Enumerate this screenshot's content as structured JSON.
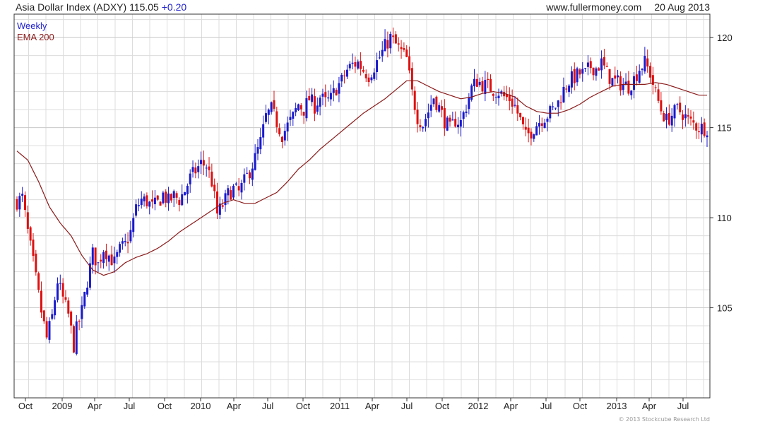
{
  "header": {
    "title": "Asia Dollar Index (ADXY)",
    "last": "115.05",
    "change": "+0.20",
    "site": "www.fullermoney.com",
    "date": "20 Aug 2013"
  },
  "copyright": "© 2013 Stockcube Research Ltd",
  "colors": {
    "up": "#1a1acc",
    "down": "#dd1111",
    "ema": "#8b1a1a",
    "grid": "#dcdcdc",
    "axis": "#333333"
  },
  "chart_data": {
    "type": "candlestick",
    "legend": [
      {
        "label": "Weekly",
        "color": "#2222cc"
      },
      {
        "label": "EMA 200",
        "color": "#8b1a1a"
      }
    ],
    "y_range": [
      100,
      121.3
    ],
    "y_ticks": [
      105,
      110,
      115,
      120
    ],
    "x_tick_labels": [
      "Oct",
      "2009",
      "Apr",
      "Jul",
      "Oct",
      "2010",
      "Apr",
      "Jul",
      "Oct",
      "2011",
      "Apr",
      "Jul",
      "Oct",
      "2012",
      "Apr",
      "Jul",
      "Oct",
      "2013",
      "Apr",
      "Jul"
    ],
    "weeks_total": 256,
    "close_path": [
      [
        0,
        110.9
      ],
      [
        2,
        111.1
      ],
      [
        4,
        109.2
      ],
      [
        6,
        107.5
      ],
      [
        9,
        104.8
      ],
      [
        11,
        103.3
      ],
      [
        13,
        104.5
      ],
      [
        15,
        106.5
      ],
      [
        17,
        105.5
      ],
      [
        19,
        104.6
      ],
      [
        21,
        102.9
      ],
      [
        22,
        103.8
      ],
      [
        24,
        104.8
      ],
      [
        26,
        106.5
      ],
      [
        28,
        108.0
      ],
      [
        30,
        107.4
      ],
      [
        32,
        108.3
      ],
      [
        34,
        107.9
      ],
      [
        36,
        107.5
      ],
      [
        38,
        108.2
      ],
      [
        40,
        108.5
      ],
      [
        42,
        109.2
      ],
      [
        44,
        110.5
      ],
      [
        46,
        111.0
      ],
      [
        48,
        110.9
      ],
      [
        50,
        110.6
      ],
      [
        52,
        110.8
      ],
      [
        54,
        111.3
      ],
      [
        56,
        110.9
      ],
      [
        58,
        111.2
      ],
      [
        60,
        111.0
      ],
      [
        62,
        111.5
      ],
      [
        64,
        112.2
      ],
      [
        66,
        112.6
      ],
      [
        68,
        113.0
      ],
      [
        70,
        112.9
      ],
      [
        72,
        112.0
      ],
      [
        74,
        110.2
      ],
      [
        76,
        110.7
      ],
      [
        78,
        111.3
      ],
      [
        80,
        111.6
      ],
      [
        82,
        111.4
      ],
      [
        84,
        112.0
      ],
      [
        86,
        112.6
      ],
      [
        88,
        113.3
      ],
      [
        90,
        114.2
      ],
      [
        92,
        115.6
      ],
      [
        94,
        116.0
      ],
      [
        96,
        115.3
      ],
      [
        98,
        114.6
      ],
      [
        100,
        115.1
      ],
      [
        102,
        115.6
      ],
      [
        104,
        116.3
      ],
      [
        106,
        116.0
      ],
      [
        108,
        116.6
      ],
      [
        110,
        116.2
      ],
      [
        112,
        116.7
      ],
      [
        114,
        116.4
      ],
      [
        116,
        116.6
      ],
      [
        118,
        117.2
      ],
      [
        120,
        117.6
      ],
      [
        122,
        118.2
      ],
      [
        124,
        118.5
      ],
      [
        126,
        118.6
      ],
      [
        128,
        118.2
      ],
      [
        130,
        117.9
      ],
      [
        132,
        118.4
      ],
      [
        134,
        118.9
      ],
      [
        136,
        119.5
      ],
      [
        138,
        120.0
      ],
      [
        140,
        119.6
      ],
      [
        142,
        119.2
      ],
      [
        144,
        118.8
      ],
      [
        146,
        116.9
      ],
      [
        148,
        115.6
      ],
      [
        150,
        115.2
      ],
      [
        152,
        115.9
      ],
      [
        154,
        116.7
      ],
      [
        156,
        116.1
      ],
      [
        158,
        115.4
      ],
      [
        160,
        114.9
      ],
      [
        162,
        115.4
      ],
      [
        164,
        115.3
      ],
      [
        166,
        116.2
      ],
      [
        168,
        117.2
      ],
      [
        170,
        117.6
      ],
      [
        172,
        117.4
      ],
      [
        174,
        117.3
      ],
      [
        176,
        117.1
      ],
      [
        178,
        117.0
      ],
      [
        180,
        116.7
      ],
      [
        182,
        116.6
      ],
      [
        184,
        116.2
      ],
      [
        186,
        115.4
      ],
      [
        188,
        114.5
      ],
      [
        190,
        114.8
      ],
      [
        192,
        115.2
      ],
      [
        194,
        115.5
      ],
      [
        196,
        115.7
      ],
      [
        198,
        116.0
      ],
      [
        200,
        116.4
      ],
      [
        202,
        117.1
      ],
      [
        204,
        117.6
      ],
      [
        206,
        117.8
      ],
      [
        208,
        118.0
      ],
      [
        210,
        118.0
      ],
      [
        212,
        118.4
      ],
      [
        214,
        118.3
      ],
      [
        216,
        118.6
      ],
      [
        218,
        118.0
      ],
      [
        220,
        117.6
      ],
      [
        222,
        117.5
      ],
      [
        224,
        117.4
      ],
      [
        226,
        117.3
      ],
      [
        228,
        117.7
      ],
      [
        230,
        118.3
      ],
      [
        232,
        118.6
      ],
      [
        234,
        118.0
      ],
      [
        236,
        116.9
      ],
      [
        238,
        116.0
      ],
      [
        240,
        115.4
      ],
      [
        242,
        115.7
      ],
      [
        244,
        116.0
      ],
      [
        246,
        115.8
      ],
      [
        248,
        115.4
      ],
      [
        250,
        115.2
      ],
      [
        252,
        115.0
      ]
    ],
    "ema200_path": [
      [
        0,
        113.7
      ],
      [
        4,
        113.2
      ],
      [
        8,
        112.0
      ],
      [
        12,
        110.6
      ],
      [
        16,
        109.7
      ],
      [
        20,
        109.0
      ],
      [
        24,
        107.9
      ],
      [
        28,
        107.1
      ],
      [
        32,
        106.8
      ],
      [
        36,
        107.0
      ],
      [
        40,
        107.5
      ],
      [
        44,
        107.8
      ],
      [
        48,
        108.0
      ],
      [
        52,
        108.3
      ],
      [
        56,
        108.7
      ],
      [
        60,
        109.2
      ],
      [
        64,
        109.6
      ],
      [
        68,
        110.0
      ],
      [
        72,
        110.4
      ],
      [
        76,
        110.8
      ],
      [
        80,
        111.0
      ],
      [
        84,
        110.8
      ],
      [
        88,
        110.8
      ],
      [
        92,
        111.1
      ],
      [
        96,
        111.4
      ],
      [
        100,
        112.0
      ],
      [
        104,
        112.7
      ],
      [
        108,
        113.2
      ],
      [
        112,
        113.8
      ],
      [
        116,
        114.3
      ],
      [
        120,
        114.8
      ],
      [
        124,
        115.3
      ],
      [
        128,
        115.8
      ],
      [
        132,
        116.2
      ],
      [
        136,
        116.6
      ],
      [
        140,
        117.1
      ],
      [
        144,
        117.6
      ],
      [
        148,
        117.6
      ],
      [
        152,
        117.3
      ],
      [
        156,
        117.0
      ],
      [
        160,
        116.8
      ],
      [
        164,
        116.6
      ],
      [
        168,
        116.7
      ],
      [
        172,
        116.9
      ],
      [
        176,
        117.0
      ],
      [
        180,
        116.9
      ],
      [
        184,
        116.7
      ],
      [
        188,
        116.2
      ],
      [
        192,
        115.9
      ],
      [
        196,
        115.8
      ],
      [
        200,
        115.8
      ],
      [
        204,
        116.0
      ],
      [
        208,
        116.3
      ],
      [
        212,
        116.7
      ],
      [
        216,
        117.0
      ],
      [
        220,
        117.3
      ],
      [
        224,
        117.4
      ],
      [
        228,
        117.4
      ],
      [
        232,
        117.4
      ],
      [
        236,
        117.5
      ],
      [
        240,
        117.4
      ],
      [
        244,
        117.2
      ],
      [
        248,
        117.0
      ],
      [
        252,
        116.8
      ]
    ]
  }
}
